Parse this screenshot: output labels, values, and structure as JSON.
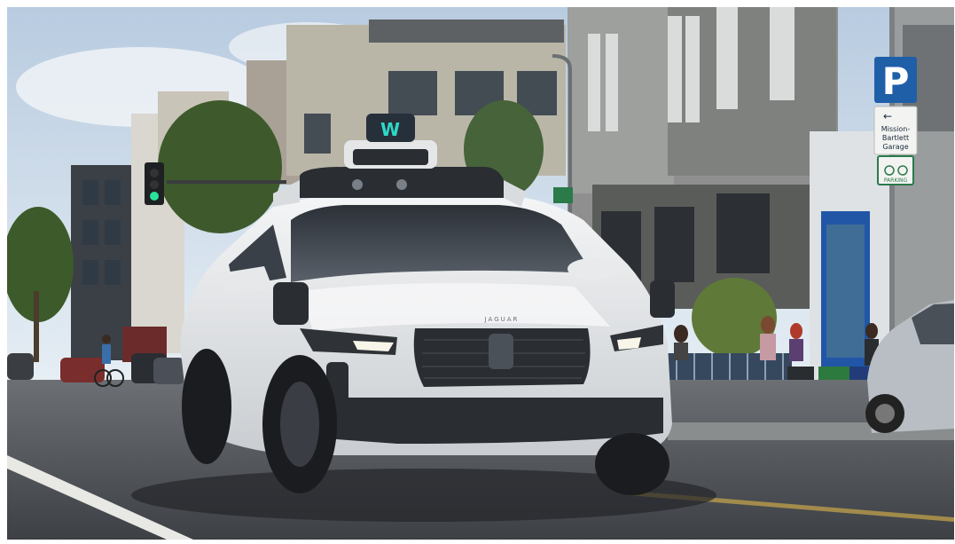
{
  "scene": {
    "vehicle_roof_logo": "W",
    "vehicle_badge": "JAGUAR",
    "parking_sign": {
      "letter": "P",
      "arrow": "←",
      "lines": [
        "Mission-",
        "Bartlett",
        "Garage"
      ],
      "bike_label": "PARKING"
    }
  },
  "colors": {
    "sky": "#dbe6f0",
    "car_body": "#e8eaec",
    "asphalt": "#4a4d52",
    "sign_blue": "#1f5fa8",
    "sensor_teal": "#2fd7c7"
  }
}
